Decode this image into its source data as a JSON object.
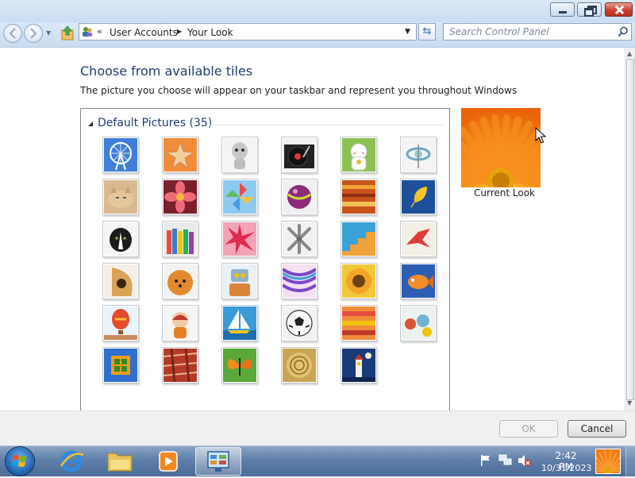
{
  "window": {
    "minimize_label": "Minimize",
    "restore_label": "Restore Down",
    "close_label": "Close"
  },
  "navbar": {
    "breadcrumb": [
      "User Accounts",
      "Your Look"
    ],
    "search_placeholder": "Search Control Panel"
  },
  "content": {
    "heading": "Choose from available tiles",
    "subtext": "The picture you choose will appear on your taskbar and represent you throughout Windows",
    "group": {
      "label": "Default Pictures (35)",
      "count": 35
    },
    "tiles": [
      {
        "name": "tile-ferris-wheel",
        "icon": "ferris-wheel"
      },
      {
        "name": "tile-starfish",
        "icon": "starfish"
      },
      {
        "name": "tile-robot-toy",
        "icon": "robot-toy"
      },
      {
        "name": "tile-turntable",
        "icon": "turntable"
      },
      {
        "name": "tile-lucky-cat",
        "icon": "lucky-cat"
      },
      {
        "name": "tile-gyroscope",
        "icon": "gyroscope"
      },
      {
        "name": "tile-kitten",
        "icon": "kitten"
      },
      {
        "name": "tile-pink-flower",
        "icon": "pink-flower"
      },
      {
        "name": "tile-pinwheel",
        "icon": "pinwheel"
      },
      {
        "name": "tile-ball",
        "icon": "purple-ball"
      },
      {
        "name": "tile-fabric",
        "icon": "fabric"
      },
      {
        "name": "tile-leaf",
        "icon": "leaf"
      },
      {
        "name": "tile-dog",
        "icon": "dog"
      },
      {
        "name": "tile-crayons",
        "icon": "crayons"
      },
      {
        "name": "tile-red-burst",
        "icon": "red-burst"
      },
      {
        "name": "tile-jacks",
        "icon": "jacks"
      },
      {
        "name": "tile-stairs",
        "icon": "stairs"
      },
      {
        "name": "tile-origami",
        "icon": "origami-crane"
      },
      {
        "name": "tile-guitar",
        "icon": "guitar"
      },
      {
        "name": "tile-pomeranian",
        "icon": "pomeranian"
      },
      {
        "name": "tile-robot-toy-2",
        "icon": "robot"
      },
      {
        "name": "tile-yarn",
        "icon": "yarn"
      },
      {
        "name": "tile-sunflower",
        "icon": "sunflower"
      },
      {
        "name": "tile-fish",
        "icon": "fish"
      },
      {
        "name": "tile-balloon",
        "icon": "hot-air-balloon"
      },
      {
        "name": "tile-doll",
        "icon": "doll"
      },
      {
        "name": "tile-sailboat",
        "icon": "sailboat"
      },
      {
        "name": "tile-soccer-ball",
        "icon": "soccer-ball"
      },
      {
        "name": "tile-ribbons",
        "icon": "ribbons"
      },
      {
        "name": "tile-marbles",
        "icon": "marbles"
      },
      {
        "name": "tile-window",
        "icon": "window"
      },
      {
        "name": "tile-textile",
        "icon": "textile"
      },
      {
        "name": "tile-butterfly",
        "icon": "butterfly"
      },
      {
        "name": "tile-shell",
        "icon": "shell"
      },
      {
        "name": "tile-lighthouse",
        "icon": "lighthouse"
      }
    ],
    "current_label": "Current Look"
  },
  "footer": {
    "ok_label": "OK",
    "cancel_label": "Cancel"
  },
  "taskbar": {
    "time": "2:42 PM",
    "date": "10/31/2023",
    "items": [
      "start-button",
      "internet-explorer",
      "windows-explorer",
      "media-player",
      "control-panel"
    ]
  },
  "colors": {
    "heading": "#1e3a75",
    "accent": "#f07a10",
    "taskbar": "#5f7ea8"
  }
}
